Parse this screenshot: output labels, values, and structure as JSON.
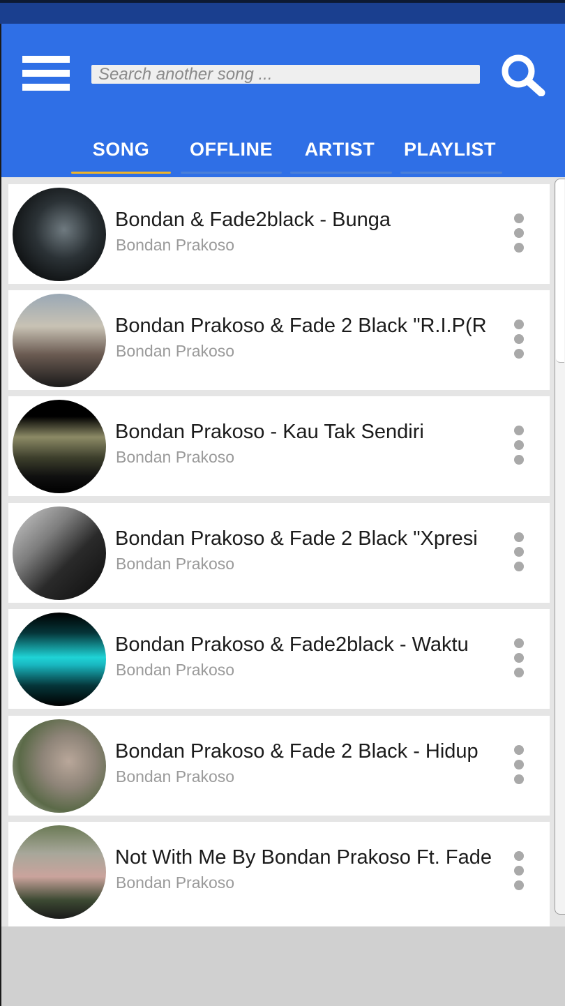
{
  "header": {
    "search_placeholder": "Search another song ...",
    "accent": "#2f6fe6",
    "tab_indicator": "#f0b429"
  },
  "tabs": [
    {
      "label": "SONG",
      "active": true
    },
    {
      "label": "OFFLINE",
      "active": false
    },
    {
      "label": "ARTIST",
      "active": false
    },
    {
      "label": "PLAYLIST",
      "active": false
    }
  ],
  "songs": [
    {
      "title": "Bondan & Fade2black - Bunga",
      "artist": "Bondan Prakoso"
    },
    {
      "title": "Bondan Prakoso & Fade 2 Black \"R.I.P(R",
      "artist": "Bondan Prakoso"
    },
    {
      "title": "Bondan Prakoso - Kau Tak Sendiri",
      "artist": "Bondan Prakoso"
    },
    {
      "title": "Bondan Prakoso & Fade 2 Black  \"Xpresi",
      "artist": "Bondan Prakoso"
    },
    {
      "title": "Bondan Prakoso & Fade2black - Waktu",
      "artist": "Bondan Prakoso"
    },
    {
      "title": "Bondan Prakoso & Fade 2 Black - Hidup",
      "artist": "Bondan Prakoso"
    },
    {
      "title": "Not With Me By Bondan Prakoso Ft. Fade",
      "artist": "Bondan Prakoso"
    }
  ],
  "icons": {
    "menu": "hamburger-menu-icon",
    "search": "search-icon",
    "more": "more-vertical-icon"
  }
}
